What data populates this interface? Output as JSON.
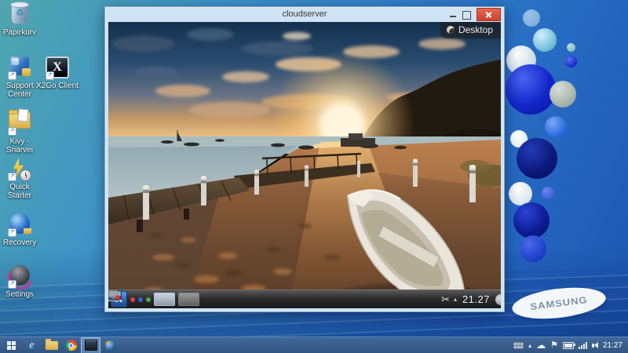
{
  "desktop": {
    "icons": [
      {
        "label": "Papirkurv",
        "icon": "recycle-bin-icon"
      },
      {
        "label": "Support Center",
        "icon": "support-center-icon"
      },
      {
        "label": "X2Go Client",
        "icon": "x2go-client-icon"
      },
      {
        "label": "Kivy - Snarvei",
        "icon": "folder-shortcut-icon"
      },
      {
        "label": "Quick Starter",
        "icon": "quick-starter-icon"
      },
      {
        "label": "Recovery",
        "icon": "recovery-icon"
      },
      {
        "label": "Settings",
        "icon": "settings-icon"
      }
    ],
    "wallpaper_brand": "SAMSUNG"
  },
  "window": {
    "title": "cloudserver",
    "controls": [
      "minimize",
      "maximize",
      "close"
    ],
    "remote_desktop": {
      "toolbox_label": "Desktop",
      "panel": {
        "launcher": "kde-menu",
        "activity_dots": [
          "red",
          "blue",
          "green"
        ],
        "virtual_desktops": 2,
        "menu_glyph": "K",
        "tray_icons": [
          "konsole-icon",
          "display-icon",
          "klipper-scissors-icon",
          "volume-icon",
          "network-offline-icon",
          "expand-arrow-icon"
        ],
        "scissors_glyph": "✂",
        "caret_glyph": "▴",
        "clock": "21.27"
      }
    }
  },
  "taskbar": {
    "buttons": [
      "start",
      "internet-explorer",
      "file-explorer",
      "chrome",
      "x2go-session",
      "support-center"
    ],
    "active_button": "x2go-session",
    "ie_glyph": "e",
    "tray": {
      "icons": [
        "keyboard-icon",
        "expand-caret-icon",
        "onedrive-cloud-icon",
        "action-center-flag-icon",
        "power-icon",
        "network-signal-icon",
        "volume-icon"
      ],
      "caret_glyph": "▴",
      "cloud_glyph": "☁",
      "flag_glyph": "⚑",
      "clock": "21:27"
    }
  },
  "shortcut_arrow_glyph": "↗",
  "recycle_glyph": "♻",
  "colors": {
    "taskbar_blue": "#35598a",
    "close_red": "#d0402e",
    "window_chrome": "#cfe3f2",
    "kde_panel_dark": "#2a2a2a",
    "wallpaper_teal": "#4fa6ae",
    "wallpaper_blue": "#1c55ae"
  }
}
